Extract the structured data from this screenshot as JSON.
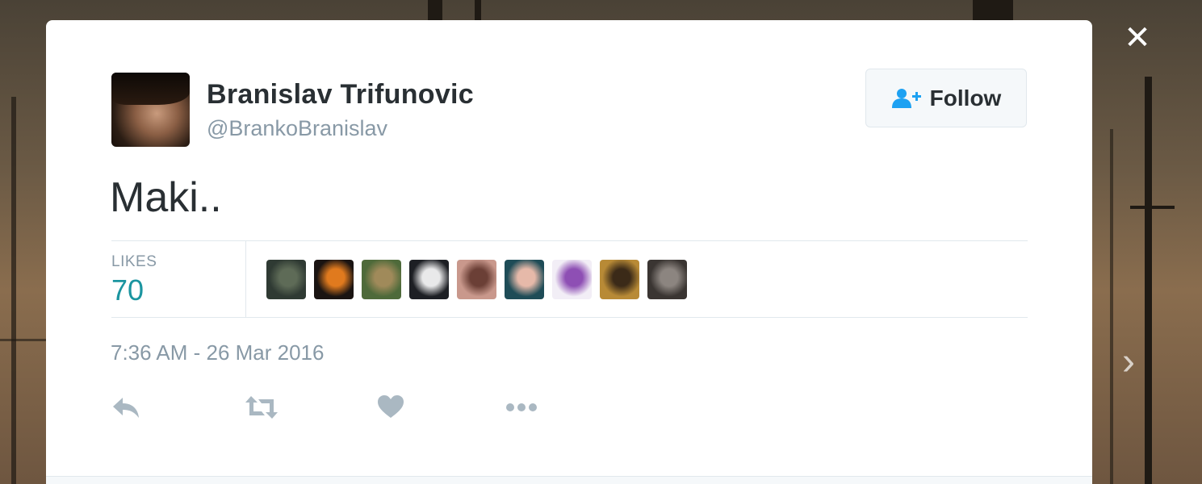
{
  "overlay": {
    "close_icon": "close-icon",
    "next_icon": "chevron-right-icon"
  },
  "tweet": {
    "author": {
      "name": "Branislav Trifunovic",
      "handle": "@BrankoBranislav",
      "avatar_icon": "user-avatar"
    },
    "follow_button": {
      "label": "Follow",
      "icon": "follow-user-icon"
    },
    "text": "Maki..",
    "stats": {
      "likes_label": "LIKES",
      "likes_count": "70"
    },
    "likers": [
      {
        "name": "liker-1",
        "colors": [
          "#2f3a33",
          "#5e6b57"
        ]
      },
      {
        "name": "liker-2",
        "colors": [
          "#1a1412",
          "#e07a1e"
        ]
      },
      {
        "name": "liker-3",
        "colors": [
          "#4e6a3a",
          "#a08a5a"
        ]
      },
      {
        "name": "liker-4",
        "colors": [
          "#1d1f24",
          "#e9e9ea"
        ]
      },
      {
        "name": "liker-5",
        "colors": [
          "#c9988c",
          "#6b3f36"
        ]
      },
      {
        "name": "liker-6",
        "colors": [
          "#1e4c57",
          "#e6b9a9"
        ]
      },
      {
        "name": "liker-7",
        "colors": [
          "#f2eef6",
          "#8e4fb4"
        ]
      },
      {
        "name": "liker-8",
        "colors": [
          "#b88a36",
          "#3b2a18"
        ]
      },
      {
        "name": "liker-9",
        "colors": [
          "#3a3532",
          "#8c8580"
        ]
      }
    ],
    "timestamp": "7:36 AM - 26 Mar 2016",
    "actions": [
      {
        "name": "reply-icon"
      },
      {
        "name": "retweet-icon"
      },
      {
        "name": "like-heart-icon"
      },
      {
        "name": "more-options-icon"
      }
    ],
    "colors": {
      "likes_count": "#1b95a0",
      "muted_text": "#8899a6",
      "primary_text": "#292f33",
      "action_icon": "#aab8c2"
    }
  }
}
